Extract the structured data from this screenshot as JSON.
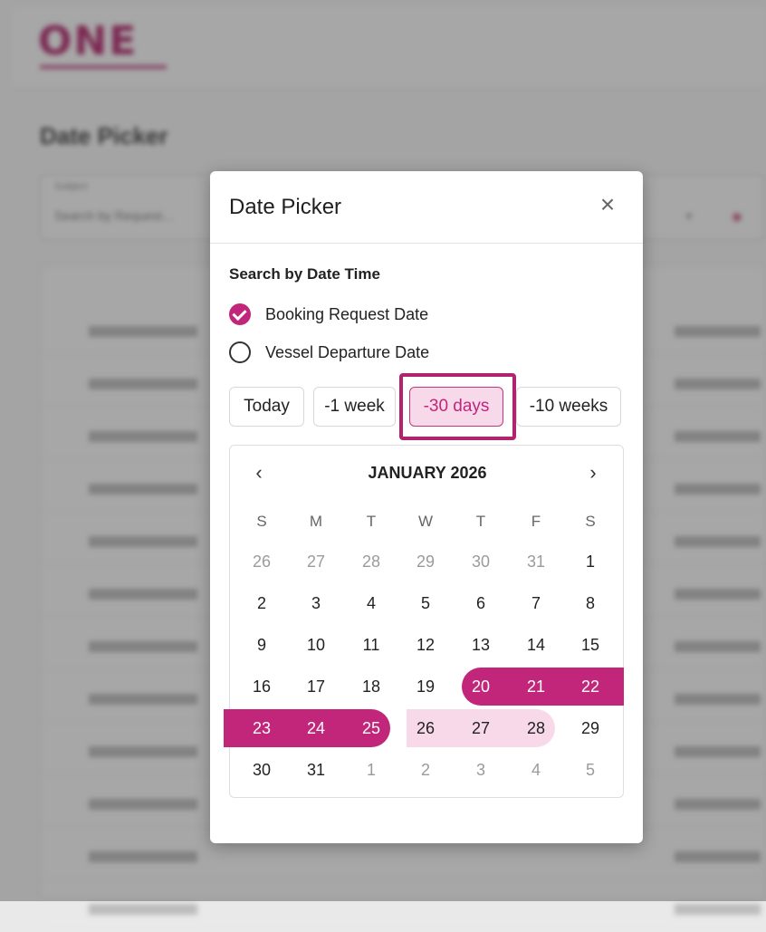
{
  "background": {
    "logo": "ONE",
    "page_title": "Date Picker",
    "field_label": "Subject",
    "field_value": "Search by Request..."
  },
  "dialog": {
    "title": "Date Picker",
    "section_label": "Search by Date Time",
    "options": [
      {
        "label": "Booking Request Date",
        "checked": true
      },
      {
        "label": "Vessel Departure Date",
        "checked": false
      }
    ],
    "quick_buttons": [
      {
        "label": "Today",
        "selected": false
      },
      {
        "label": "-1 week",
        "selected": false
      },
      {
        "label": "-30 days",
        "selected": true
      },
      {
        "label": "-10 weeks",
        "selected": false
      }
    ],
    "calendar": {
      "month": "JANUARY 2026",
      "prev_icon": "chevron-left-icon",
      "next_icon": "chevron-right-icon",
      "weekdays": [
        "S",
        "M",
        "T",
        "W",
        "T",
        "F",
        "S"
      ],
      "weeks": [
        [
          "26",
          "27",
          "28",
          "29",
          "30",
          "31",
          "1"
        ],
        [
          "2",
          "3",
          "4",
          "5",
          "6",
          "7",
          "8"
        ],
        [
          "9",
          "10",
          "11",
          "12",
          "13",
          "14",
          "15"
        ],
        [
          "16",
          "17",
          "18",
          "19",
          "20",
          "21",
          "22"
        ],
        [
          "23",
          "24",
          "25",
          "26",
          "27",
          "28",
          "29"
        ],
        [
          "30",
          "31",
          "1",
          "2",
          "3",
          "4",
          "5"
        ]
      ],
      "selected_range": [
        "20",
        "25"
      ],
      "preview_range": [
        "26",
        "28"
      ]
    }
  },
  "colors": {
    "accent": "#c1267a",
    "accent_light": "#f8d9ea",
    "highlight_border": "#b2236f"
  }
}
